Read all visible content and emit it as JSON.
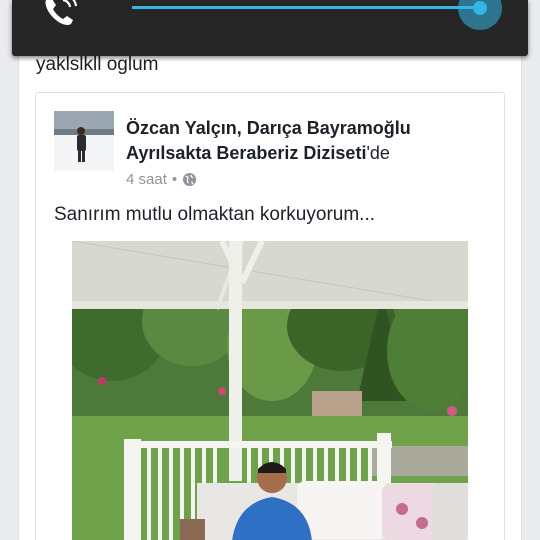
{
  "call_overlay": {
    "icon": "phone-volume-icon",
    "volume_level": 1.0,
    "accent_color": "#33b5e5"
  },
  "post": {
    "caption": "yaklslkll oglum",
    "shared": {
      "author": "Özcan Yalçın, Darıça Bayramoğlu Ayrılsakta Beraberiz Diziseti",
      "author_suffix": "'de",
      "time": "4 saat",
      "separator": "•",
      "privacy_icon": "globe-icon",
      "text": "Sanırım mutlu olmaktan korkuyorum..."
    }
  }
}
